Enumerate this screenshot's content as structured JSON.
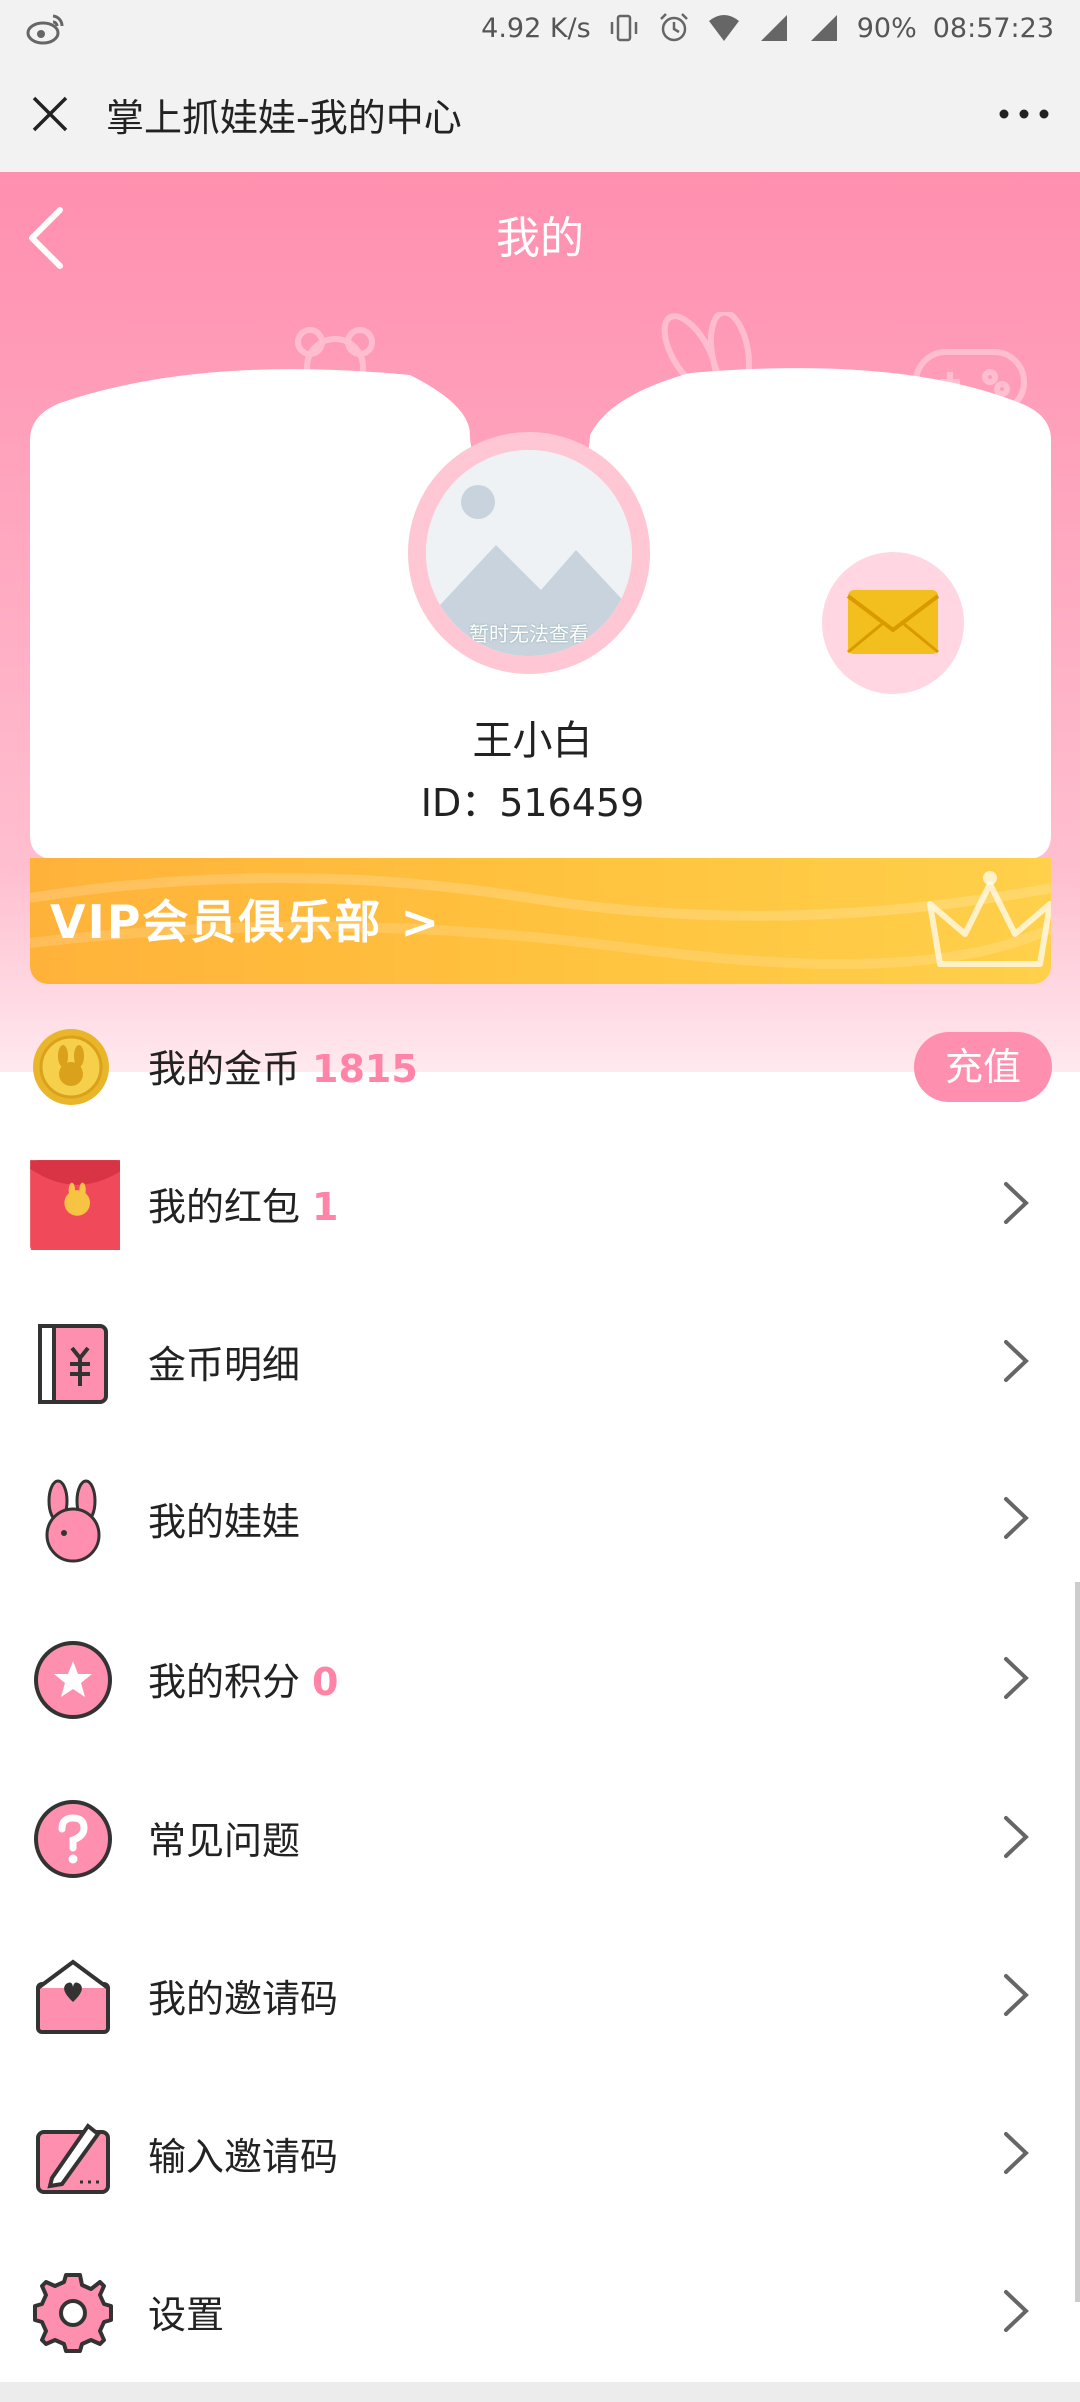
{
  "status_bar": {
    "speed": "4.92 K/s",
    "battery": "90%",
    "time": "08:57:23"
  },
  "titlebar": {
    "title": "掌上抓娃娃-我的中心"
  },
  "header": {
    "page_title": "我的"
  },
  "profile": {
    "avatar_placeholder": "暂时无法查看",
    "name": "王小白",
    "id_text": "ID：516459"
  },
  "vip": {
    "label": "VIP会员俱乐部 >"
  },
  "coins": {
    "label": "我的金币",
    "value": "1815",
    "recharge_label": "充值"
  },
  "menu": [
    {
      "label": "我的红包",
      "value": "1"
    },
    {
      "label": "金币明细",
      "value": ""
    },
    {
      "label": "我的娃娃",
      "value": ""
    },
    {
      "label": "我的积分",
      "value": "0"
    },
    {
      "label": "常见问题",
      "value": ""
    },
    {
      "label": "我的邀请码",
      "value": ""
    },
    {
      "label": "输入邀请码",
      "value": ""
    },
    {
      "label": "设置",
      "value": ""
    }
  ],
  "colors": {
    "accent_pink": "#ff8fae",
    "value_pink": "#ff84a7",
    "vip_orange": "#ffb23a"
  }
}
